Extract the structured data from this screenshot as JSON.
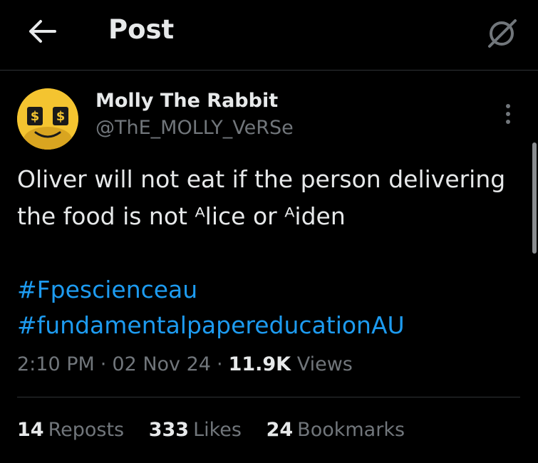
{
  "header": {
    "title": "Post",
    "back_icon": "arrow-left-icon",
    "grok_icon": "grok-icon"
  },
  "post": {
    "author": {
      "display_name": "Molly The Rabbit",
      "handle": "@ThE_MOLLY_VeRSe",
      "avatar_colors": {
        "face": "#f4c430",
        "features": "#1a1a1a"
      }
    },
    "text_lines": [
      "Oliver will not eat if the person delivering",
      "the food is not ᴬlice or ᴬiden"
    ],
    "hashtags": [
      "#Fpescienceau",
      "#fundamentalpapereducationAU"
    ],
    "time": "2:10 PM",
    "date": "02 Nov 24",
    "views_count": "11.9K",
    "views_label": "Views"
  },
  "stats": {
    "reposts_count": "14",
    "reposts_label": "Reposts",
    "likes_count": "333",
    "likes_label": "Likes",
    "bookmarks_count": "24",
    "bookmarks_label": "Bookmarks"
  },
  "colors": {
    "background": "#000000",
    "text_primary": "#e7e9ea",
    "text_secondary": "#71767b",
    "link": "#1d9bf0",
    "divider": "#2f3336"
  }
}
